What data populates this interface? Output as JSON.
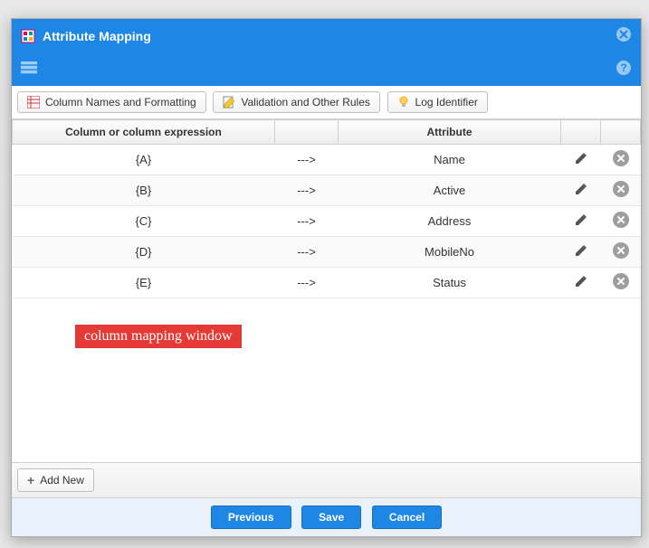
{
  "title": "Attribute Mapping",
  "tabs": {
    "columns": "Column Names and Formatting",
    "validation": "Validation and Other Rules",
    "log": "Log Identifier"
  },
  "headers": {
    "expr": "Column or column expression",
    "arrow": "",
    "attr": "Attribute",
    "edit": "",
    "del": ""
  },
  "arrow_text": "--->",
  "rows": [
    {
      "expr": "{A}",
      "attr": "Name"
    },
    {
      "expr": "{B}",
      "attr": "Active"
    },
    {
      "expr": "{C}",
      "attr": "Address"
    },
    {
      "expr": "{D}",
      "attr": "MobileNo"
    },
    {
      "expr": "{E}",
      "attr": "Status"
    }
  ],
  "add_new": "Add New",
  "buttons": {
    "previous": "Previous",
    "save": "Save",
    "cancel": "Cancel"
  },
  "annotation": {
    "label": "column mapping window"
  }
}
